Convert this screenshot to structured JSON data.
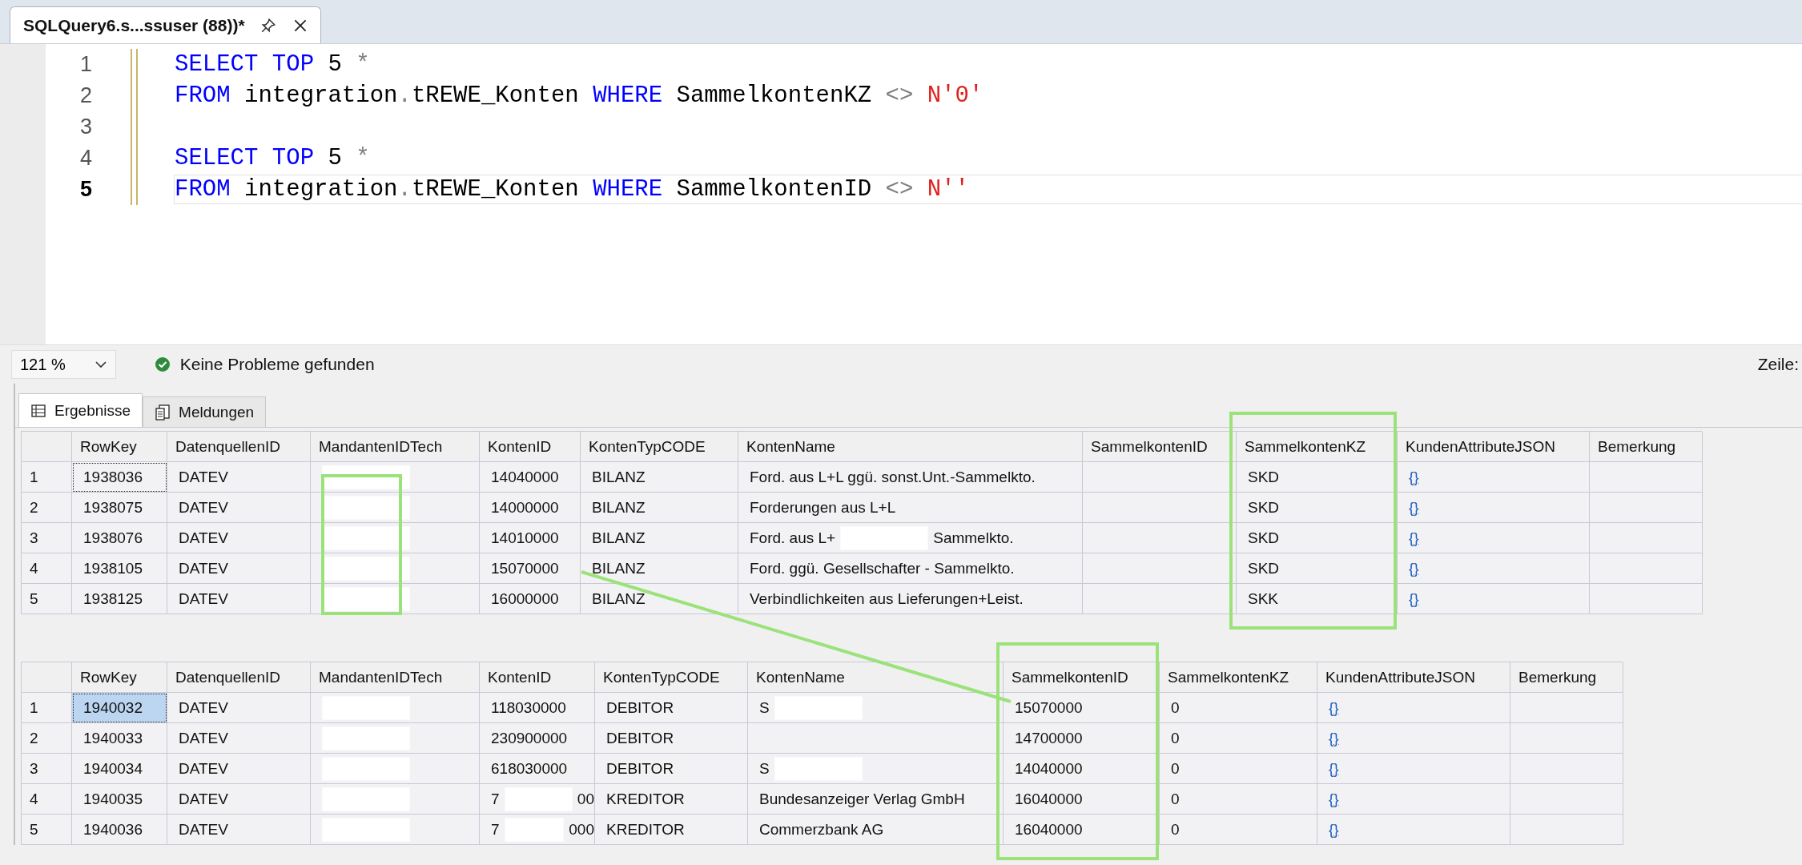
{
  "document_tab": {
    "title": "SQLQuery6.s...ssuser (88))*",
    "pinned": false
  },
  "editor": {
    "lines": [
      {
        "number": "1",
        "current": false,
        "tokens": [
          {
            "kind": "keyword",
            "text": "SELECT TOP"
          },
          {
            "kind": "plain",
            "text": " 5 "
          },
          {
            "kind": "operator",
            "text": "*"
          }
        ]
      },
      {
        "number": "2",
        "current": false,
        "tokens": [
          {
            "kind": "keyword",
            "text": "FROM"
          },
          {
            "kind": "plain",
            "text": " integration"
          },
          {
            "kind": "operator",
            "text": "."
          },
          {
            "kind": "plain",
            "text": "tREWE_Konten "
          },
          {
            "kind": "keyword",
            "text": "WHERE"
          },
          {
            "kind": "plain",
            "text": " SammelkontenKZ "
          },
          {
            "kind": "operator",
            "text": "<>"
          },
          {
            "kind": "string",
            "text": " N'0'"
          }
        ]
      },
      {
        "number": "3",
        "current": false
      },
      {
        "number": "4",
        "current": false,
        "tokens": [
          {
            "kind": "keyword",
            "text": "SELECT TOP"
          },
          {
            "kind": "plain",
            "text": " 5 "
          },
          {
            "kind": "operator",
            "text": "*"
          }
        ]
      },
      {
        "number": "5",
        "current": true,
        "tokens": [
          {
            "kind": "keyword",
            "text": "FROM"
          },
          {
            "kind": "plain",
            "text": " integration"
          },
          {
            "kind": "operator",
            "text": "."
          },
          {
            "kind": "plain",
            "text": "tREWE_Konten "
          },
          {
            "kind": "keyword",
            "text": "WHERE"
          },
          {
            "kind": "plain",
            "text": " SammelkontenID "
          },
          {
            "kind": "operator",
            "text": "<>"
          },
          {
            "kind": "string",
            "text": " N''"
          }
        ]
      }
    ]
  },
  "status_bar": {
    "zoom": "121 %",
    "message": "Keine Probleme gefunden",
    "position_label": "Zeile:"
  },
  "result_tabs": [
    {
      "label": "Ergebnisse",
      "selected": true
    },
    {
      "label": "Meldungen",
      "selected": false
    }
  ],
  "result_grids": [
    {
      "columns": [
        {
          "name": "RowKey",
          "kind": "text",
          "highlighted": false
        },
        {
          "name": "DatenquellenID",
          "kind": "text",
          "highlighted": false
        },
        {
          "name": "MandantenIDTech",
          "kind": "text",
          "highlighted": true
        },
        {
          "name": "KontenID",
          "kind": "text",
          "highlighted": false
        },
        {
          "name": "KontenTypCODE",
          "kind": "text",
          "highlighted": false
        },
        {
          "name": "KontenName",
          "kind": "text",
          "highlighted": false
        },
        {
          "name": "SammelkontenID",
          "kind": "text",
          "highlighted": false
        },
        {
          "name": "SammelkontenKZ",
          "kind": "text",
          "highlighted": true
        },
        {
          "name": "KundenAttributeJSON",
          "kind": "link",
          "highlighted": false
        },
        {
          "name": "Bemerkung",
          "kind": "text",
          "highlighted": false
        }
      ],
      "rows": [
        {
          "number": "1",
          "focused": true,
          "selected": false,
          "cells": [
            "1938036",
            "DATEV",
            {
              "redacted": true
            },
            "14040000",
            "BILANZ",
            "Ford. aus L+L ggü. sonst.Unt.-Sammelkto.",
            null,
            "SKD",
            "{}",
            null
          ]
        },
        {
          "number": "2",
          "focused": false,
          "selected": false,
          "cells": [
            "1938075",
            "DATEV",
            {
              "redacted": true
            },
            "14000000",
            "BILANZ",
            "Forderungen aus L+L",
            null,
            "SKD",
            "{}",
            null
          ]
        },
        {
          "number": "3",
          "focused": false,
          "selected": false,
          "cells": [
            "1938076",
            "DATEV",
            {
              "redacted": true
            },
            "14010000",
            "BILANZ",
            {
              "text": "Ford. aus L+",
              "redacted": true,
              "tail": "Sammelkto."
            },
            null,
            "SKD",
            "{}",
            null
          ]
        },
        {
          "number": "4",
          "focused": false,
          "selected": false,
          "cells": [
            "1938105",
            "DATEV",
            {
              "redacted": true
            },
            "15070000",
            "BILANZ",
            "Ford. ggü. Gesellschafter - Sammelkto.",
            null,
            "SKD",
            "{}",
            null
          ]
        },
        {
          "number": "5",
          "focused": false,
          "selected": false,
          "cells": [
            "1938125",
            "DATEV",
            {
              "redacted": true
            },
            "16000000",
            "BILANZ",
            "Verbindlichkeiten aus Lieferungen+Leist.",
            null,
            "SKK",
            "{}",
            null
          ]
        }
      ]
    },
    {
      "columns": [
        {
          "name": "RowKey",
          "kind": "text",
          "highlighted": false
        },
        {
          "name": "DatenquellenID",
          "kind": "text",
          "highlighted": false
        },
        {
          "name": "MandantenIDTech",
          "kind": "text",
          "highlighted": false
        },
        {
          "name": "KontenID",
          "kind": "text",
          "highlighted": false
        },
        {
          "name": "KontenTypCODE",
          "kind": "text",
          "highlighted": false
        },
        {
          "name": "KontenName",
          "kind": "text",
          "highlighted": false
        },
        {
          "name": "SammelkontenID",
          "kind": "text",
          "highlighted": true
        },
        {
          "name": "SammelkontenKZ",
          "kind": "text",
          "highlighted": false
        },
        {
          "name": "KundenAttributeJSON",
          "kind": "link",
          "highlighted": false
        },
        {
          "name": "Bemerkung",
          "kind": "text",
          "highlighted": false
        }
      ],
      "rows": [
        {
          "number": "1",
          "focused": true,
          "selected": true,
          "cells": [
            "1940032",
            "DATEV",
            {
              "redacted": true
            },
            "118030000",
            "DEBITOR",
            {
              "text": "S",
              "redacted": true
            },
            "15070000",
            "0",
            "{}",
            null
          ]
        },
        {
          "number": "2",
          "focused": false,
          "selected": false,
          "cells": [
            "1940033",
            "DATEV",
            {
              "redacted": true
            },
            "230900000",
            "DEBITOR",
            null,
            "14700000",
            "0",
            "{}",
            null
          ]
        },
        {
          "number": "3",
          "focused": false,
          "selected": false,
          "cells": [
            "1940034",
            "DATEV",
            {
              "redacted": true
            },
            "618030000",
            "DEBITOR",
            {
              "text": "S",
              "redacted": true
            },
            "14040000",
            "0",
            "{}",
            null
          ]
        },
        {
          "number": "4",
          "focused": false,
          "selected": false,
          "cells": [
            "1940035",
            "DATEV",
            {
              "redacted": true
            },
            {
              "text": "7",
              "redacted": true,
              "tail": "00"
            },
            "KREDITOR",
            "Bundesanzeiger Verlag GmbH",
            "16040000",
            "0",
            "{}",
            null
          ]
        },
        {
          "number": "5",
          "focused": false,
          "selected": false,
          "cells": [
            "1940036",
            "DATEV",
            {
              "redacted": true
            },
            {
              "text": "7",
              "redacted": true,
              "tail": "000"
            },
            "KREDITOR",
            "Commerzbank AG",
            "16040000",
            "0",
            "{}",
            null
          ]
        }
      ]
    }
  ]
}
